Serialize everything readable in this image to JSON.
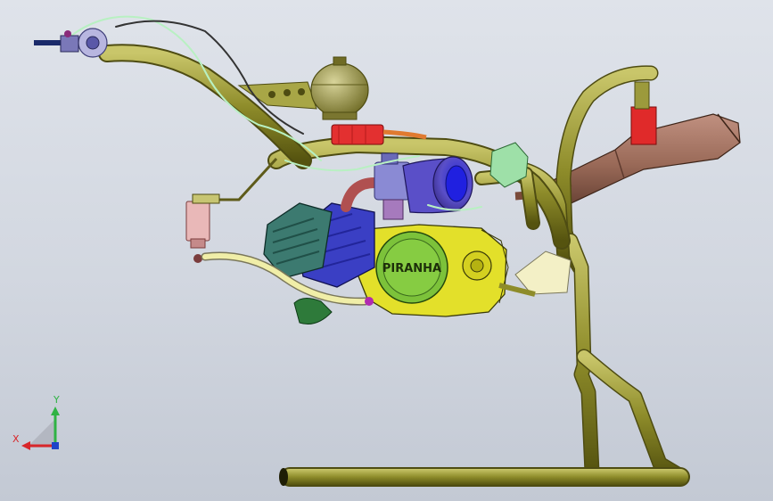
{
  "engine": {
    "brand_label": "PIRANHA"
  },
  "triad": {
    "x_label": "X",
    "y_label": "Y",
    "x_color": "#d8262a",
    "y_color": "#2fb344",
    "z_color": "#1f44c8"
  },
  "colors": {
    "frame": "#8e8c2a",
    "frame_dark": "#5f5d17",
    "crankcase": "#e3e02a",
    "clutch_cover": "#7cc23a",
    "cylinder": "#3a3fc4",
    "head": "#3c7a70",
    "air_filter": "#5a4fc8",
    "muffler": "#9a6a58",
    "tank": "#8a8636",
    "coil": "#e33030",
    "hose": "#b8f0c2"
  }
}
